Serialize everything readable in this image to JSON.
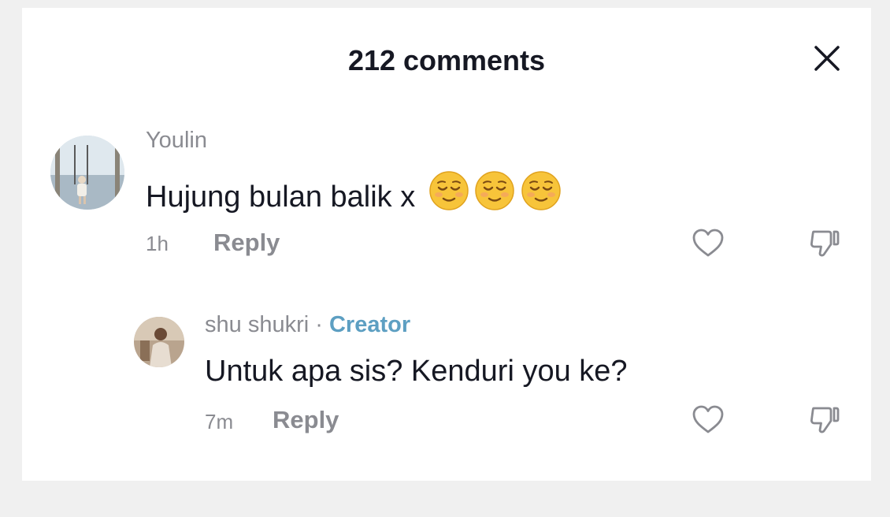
{
  "header": {
    "title": "212 comments"
  },
  "comments": [
    {
      "username": "Youlin",
      "text": "Hujung bulan balik x",
      "emoji": "relieved-face",
      "emoji_count": 3,
      "time": "1h",
      "reply_label": "Reply"
    }
  ],
  "replies": [
    {
      "username": "shu shukri",
      "separator": "·",
      "badge": "Creator",
      "text": "Untuk apa sis? Kenduri you ke?",
      "time": "7m",
      "reply_label": "Reply"
    }
  ],
  "colors": {
    "text_primary": "#161823",
    "text_secondary": "#8a8b91",
    "creator_badge": "#5d9fc2"
  },
  "icons": [
    "close-icon",
    "heart-icon",
    "dislike-icon",
    "relieved-face-emoji"
  ]
}
